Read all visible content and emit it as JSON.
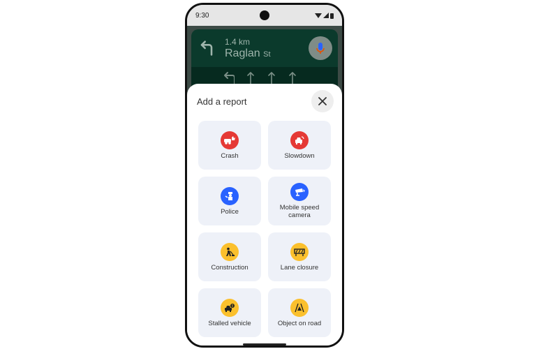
{
  "statusbar": {
    "time": "9:30"
  },
  "navigation": {
    "distance": "1.4 km",
    "street_name": "Raglan",
    "street_suffix": "St",
    "turn_icon": "turn-left-icon",
    "mic_icon": "microphone-icon"
  },
  "report_sheet": {
    "title": "Add a report",
    "close_icon": "close-icon",
    "items": [
      {
        "label": "Crash",
        "icon": "crash-icon",
        "color": "#e53935"
      },
      {
        "label": "Slowdown",
        "icon": "slowdown-icon",
        "color": "#e53935"
      },
      {
        "label": "Police",
        "icon": "police-icon",
        "color": "#2962ff"
      },
      {
        "label": "Mobile speed camera",
        "icon": "speed-camera-icon",
        "color": "#2962ff"
      },
      {
        "label": "Construction",
        "icon": "construction-icon",
        "color": "#fbc02d"
      },
      {
        "label": "Lane closure",
        "icon": "lane-closure-icon",
        "color": "#fbc02d"
      },
      {
        "label": "Stalled vehicle",
        "icon": "stalled-vehicle-icon",
        "color": "#fbc02d"
      },
      {
        "label": "Object on road",
        "icon": "object-on-road-icon",
        "color": "#fbc02d"
      }
    ]
  }
}
